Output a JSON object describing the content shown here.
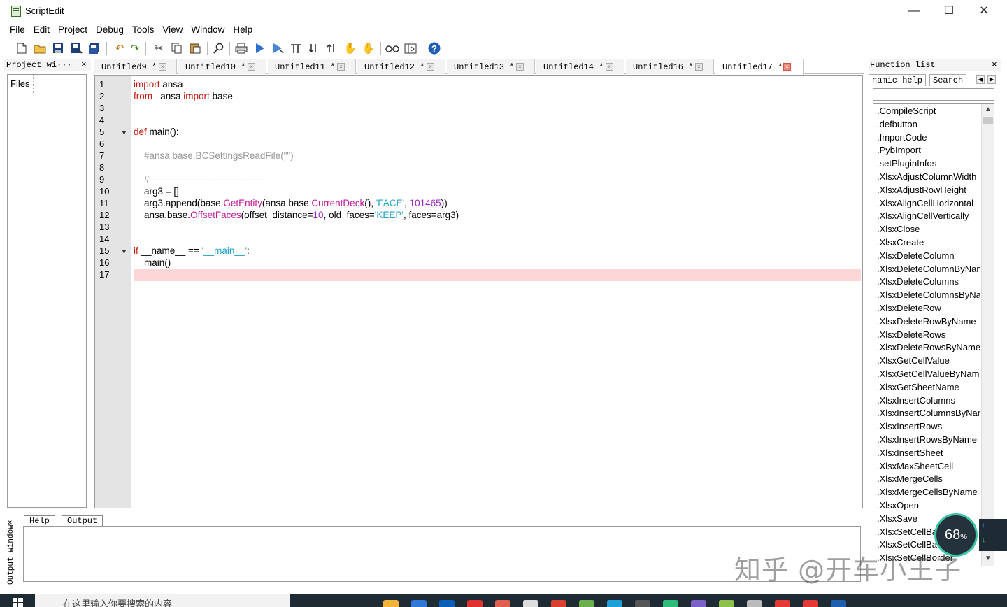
{
  "window": {
    "title": "ScriptEdit",
    "minimize": "—",
    "maximize": "☐",
    "close": "✕"
  },
  "menu": [
    "File",
    "Edit",
    "Project",
    "Debug",
    "Tools",
    "View",
    "Window",
    "Help"
  ],
  "project_panel": {
    "title": "Project wi···",
    "close": "×",
    "tree": [
      "Files"
    ]
  },
  "tabs": [
    {
      "label": "Untitled9 *",
      "active": false
    },
    {
      "label": "Untitled10 *",
      "active": false
    },
    {
      "label": "Untitled11 *",
      "active": false
    },
    {
      "label": "Untitled12 *",
      "active": false
    },
    {
      "label": "Untitled13 *",
      "active": false
    },
    {
      "label": "Untitled14 *",
      "active": false
    },
    {
      "label": "Untitled16 *",
      "active": false
    },
    {
      "label": "Untitled17 *",
      "active": true
    }
  ],
  "editor": {
    "line_numbers": [
      "1",
      "2",
      "3",
      "4",
      "5",
      "6",
      "7",
      "8",
      "9",
      "10",
      "11",
      "12",
      "13",
      "14",
      "15",
      "16",
      "17"
    ],
    "code": {
      "l1_kw": "import",
      "l1_rest": " ansa",
      "l2_kw": "from",
      "l2_mid": "   ansa ",
      "l2_kw2": "import",
      "l2_rest": " base",
      "l5_kw": "def",
      "l5_rest": " main():",
      "l7": "    #ansa.base.BCSettingsReadFile(\"\")",
      "l9": "    #-------------------------------------",
      "l10": "    arg3 = []",
      "l11_a": "    arg3.append(base.",
      "l11_fn": "GetEntity",
      "l11_b": "(ansa.base.",
      "l11_fn2": "CurrentDeck",
      "l11_c": "(), ",
      "l11_str": "'FACE'",
      "l11_d": ", ",
      "l11_num": "101465",
      "l11_e": "))",
      "l12_a": "    ansa.base.",
      "l12_fn": "OffsetFaces",
      "l12_b": "(offset_distance=",
      "l12_num": "10",
      "l12_c": ", old_faces=",
      "l12_str": "'KEEP'",
      "l12_d": ", faces=arg3)",
      "l15_kw": "if",
      "l15_a": " __name__ == ",
      "l15_str": "'__main__'",
      "l15_b": ":",
      "l16": "    main()"
    }
  },
  "function_list": {
    "title": "Function list",
    "close": "×",
    "tabs": [
      "namic help",
      "Search"
    ],
    "search_value": "",
    "items": [
      ".CompileScript",
      ".defbutton",
      ".ImportCode",
      ".PybImport",
      ".setPluginInfos",
      ".XlsxAdjustColumnWidth",
      ".XlsxAdjustRowHeight",
      ".XlsxAlignCellHorizontal",
      ".XlsxAlignCellVertically",
      ".XlsxClose",
      ".XlsxCreate",
      ".XlsxDeleteColumn",
      ".XlsxDeleteColumnByName",
      ".XlsxDeleteColumns",
      ".XlsxDeleteColumnsByName",
      ".XlsxDeleteRow",
      ".XlsxDeleteRowByName",
      ".XlsxDeleteRows",
      ".XlsxDeleteRowsByName",
      ".XlsxGetCellValue",
      ".XlsxGetCellValueByName",
      ".XlsxGetSheetName",
      ".XlsxInsertColumns",
      ".XlsxInsertColumnsByName",
      ".XlsxInsertRows",
      ".XlsxInsertRowsByName",
      ".XlsxInsertSheet",
      ".XlsxMaxSheetCell",
      ".XlsxMergeCells",
      ".XlsxMergeCellsByName",
      ".XlsxOpen",
      ".XlsxSave",
      ".XlsxSetCellBackground",
      ".XlsxSetCellBackground",
      ".XlsxSetCellBorder"
    ]
  },
  "output_panel": {
    "side_title": "Output window×",
    "tabs": [
      "Help",
      "Output"
    ]
  },
  "overlay": {
    "perf_value": "68",
    "perf_unit": "%",
    "watermark": "知乎 @开车小王子"
  },
  "taskbar": {
    "search_placeholder": "在这里输入你要搜索的内容"
  },
  "colors": {
    "keyword": "#c0190f",
    "function": "#c0199a",
    "string": "#22a0c8",
    "number": "#9a28c0",
    "comment": "#9a9a9a",
    "current_line": "#fdd7d7"
  }
}
